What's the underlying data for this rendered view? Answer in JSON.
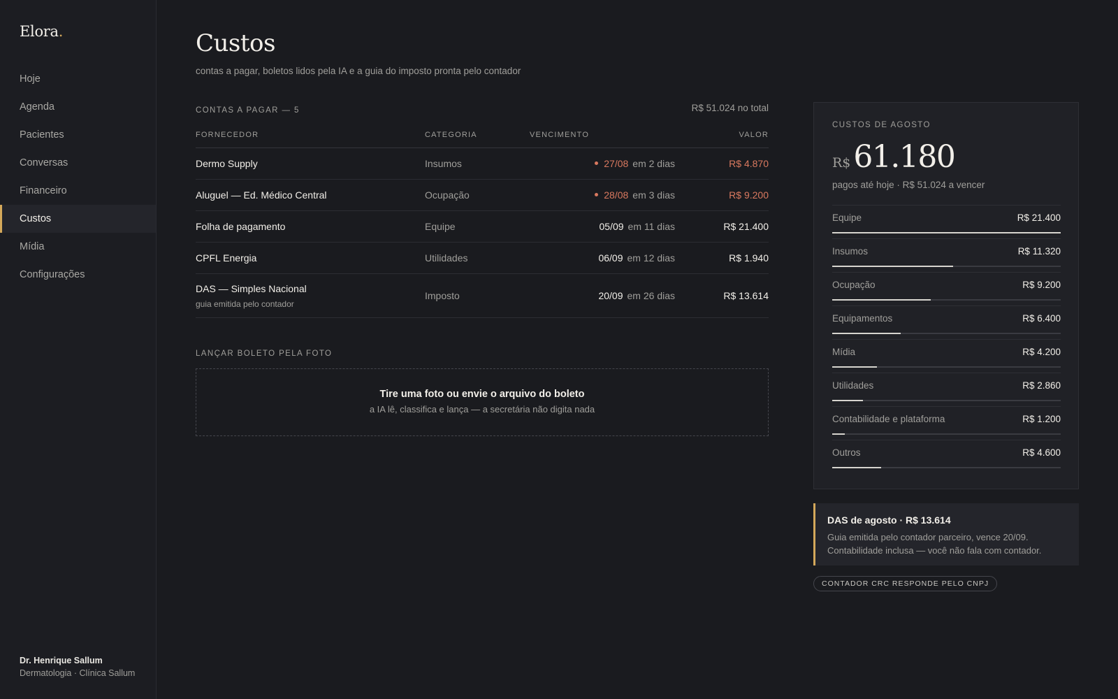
{
  "app": {
    "logo": "Elora",
    "logo_dot": "."
  },
  "sidebar": {
    "items": [
      {
        "label": "Hoje"
      },
      {
        "label": "Agenda"
      },
      {
        "label": "Pacientes"
      },
      {
        "label": "Conversas"
      },
      {
        "label": "Financeiro"
      },
      {
        "label": "Custos",
        "active": true
      },
      {
        "label": "Mídia"
      },
      {
        "label": "Configurações"
      }
    ],
    "user": {
      "name": "Dr. Henrique Sallum",
      "subtitle": "Dermatologia · Clínica Sallum"
    }
  },
  "page": {
    "title": "Custos",
    "subtitle": "contas a pagar, boletos lidos pela IA e a guia do imposto pronta pelo contador"
  },
  "bills": {
    "label": "CONTAS A PAGAR — 5",
    "total": "R$ 51.024 no total",
    "columns": {
      "supplier": "FORNECEDOR",
      "category": "CATEGORIA",
      "due": "VENCIMENTO",
      "value": "VALOR"
    },
    "rows": [
      {
        "supplier": "Dermo Supply",
        "note": "",
        "category": "Insumos",
        "date": "27/08",
        "relative": "em 2 dias",
        "value": "R$ 4.870",
        "urgent": true
      },
      {
        "supplier": "Aluguel — Ed. Médico Central",
        "note": "",
        "category": "Ocupação",
        "date": "28/08",
        "relative": "em 3 dias",
        "value": "R$ 9.200",
        "urgent": true
      },
      {
        "supplier": "Folha de pagamento",
        "note": "",
        "category": "Equipe",
        "date": "05/09",
        "relative": "em 11 dias",
        "value": "R$ 21.400",
        "urgent": false
      },
      {
        "supplier": "CPFL Energia",
        "note": "",
        "category": "Utilidades",
        "date": "06/09",
        "relative": "em 12 dias",
        "value": "R$ 1.940",
        "urgent": false
      },
      {
        "supplier": "DAS — Simples Nacional",
        "note": "guia emitida pelo contador",
        "category": "Imposto",
        "date": "20/09",
        "relative": "em 26 dias",
        "value": "R$ 13.614",
        "urgent": false
      }
    ]
  },
  "upload": {
    "label": "LANÇAR BOLETO PELA FOTO",
    "title": "Tire uma foto ou envie o arquivo do boleto",
    "subtitle": "a IA lê, classifica e lança — a secretária não digita nada"
  },
  "summary": {
    "label": "CUSTOS DE AGOSTO",
    "currency": "R$",
    "total": "61.180",
    "subtitle": "pagos até hoje · R$ 51.024 a vencer",
    "categories": [
      {
        "name": "Equipe",
        "value": "R$ 21.400",
        "amount": 21400
      },
      {
        "name": "Insumos",
        "value": "R$ 11.320",
        "amount": 11320
      },
      {
        "name": "Ocupação",
        "value": "R$ 9.200",
        "amount": 9200
      },
      {
        "name": "Equipamentos",
        "value": "R$ 6.400",
        "amount": 6400
      },
      {
        "name": "Mídia",
        "value": "R$ 4.200",
        "amount": 4200
      },
      {
        "name": "Utilidades",
        "value": "R$ 2.860",
        "amount": 2860
      },
      {
        "name": "Contabilidade e plataforma",
        "value": "R$ 1.200",
        "amount": 1200
      },
      {
        "name": "Outros",
        "value": "R$ 4.600",
        "amount": 4600
      }
    ]
  },
  "tax_note": {
    "title": "DAS de agosto · R$ 13.614",
    "body": "Guia emitida pelo contador parceiro, vence 20/09. Contabilidade inclusa — você não fala com contador."
  },
  "badge": {
    "label": "CONTADOR CRC RESPONDE PELO CNPJ"
  },
  "colors": {
    "accent": "#d4a85a",
    "urgent": "#d9795f",
    "background": "#1a1b1f"
  }
}
